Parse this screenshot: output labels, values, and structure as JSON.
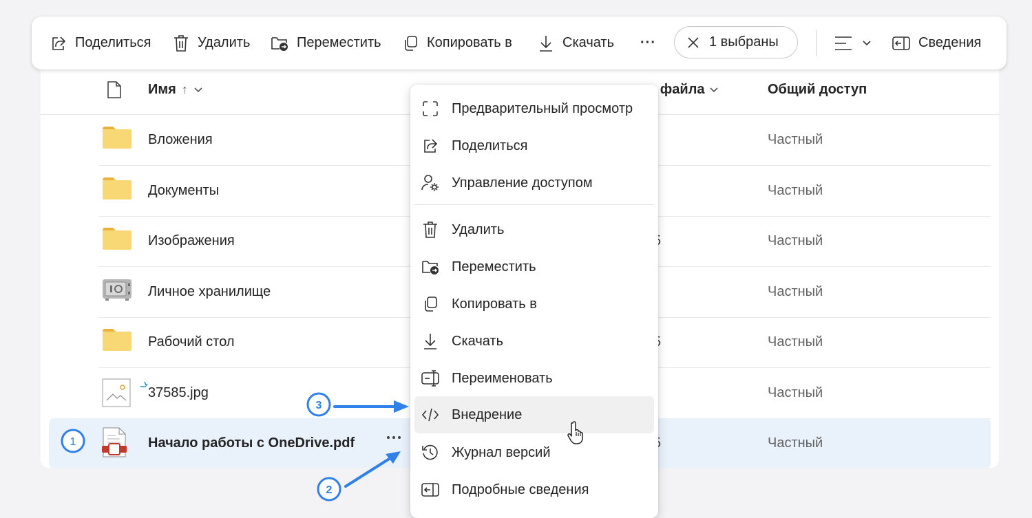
{
  "toolbar": {
    "share": "Поделиться",
    "delete": "Удалить",
    "move": "Переместить",
    "copy_to": "Копировать в",
    "download": "Скачать",
    "more": "···",
    "selection": "1 выбраны",
    "details": "Сведения"
  },
  "list_header": {
    "name": "Имя",
    "sort_glyph": "↑",
    "size": "р файла",
    "sharing": "Общий доступ"
  },
  "rows": [
    {
      "name": "Вложения",
      "size": "",
      "access": "Частный",
      "icon": "folder-icon"
    },
    {
      "name": "Документы",
      "size": "",
      "access": "Частный",
      "icon": "folder-icon"
    },
    {
      "name": "Изображения",
      "size": "5",
      "access": "Частный",
      "icon": "folder-icon"
    },
    {
      "name": "Личное хранилище",
      "size": "",
      "access": "Частный",
      "icon": "vault-icon"
    },
    {
      "name": "Рабочий стол",
      "size": "5",
      "access": "Частный",
      "icon": "folder-icon"
    },
    {
      "name": "37585.jpg",
      "size": "",
      "access": "Частный",
      "icon": "image-file-icon"
    },
    {
      "name": "Начало работы с OneDrive.pdf",
      "size": "5",
      "access": "Частный",
      "icon": "pdf-file-icon",
      "selected": true
    }
  ],
  "menu": [
    {
      "label": "Предварительный просмотр",
      "icon": "preview-icon"
    },
    {
      "label": "Поделиться",
      "icon": "share-icon"
    },
    {
      "label": "Управление доступом",
      "icon": "manage-access-icon"
    },
    {
      "label": "Удалить",
      "icon": "trash-icon"
    },
    {
      "label": "Переместить",
      "icon": "move-icon"
    },
    {
      "label": "Копировать в",
      "icon": "copy-icon"
    },
    {
      "label": "Скачать",
      "icon": "download-icon"
    },
    {
      "label": "Переименовать",
      "icon": "rename-icon"
    },
    {
      "label": "Внедрение",
      "icon": "embed-icon",
      "hover": true
    },
    {
      "label": "Журнал версий",
      "icon": "history-icon"
    },
    {
      "label": "Подробные сведения",
      "icon": "details-icon"
    }
  ],
  "annotations": [
    "1",
    "2",
    "3"
  ],
  "colors": {
    "accent": "#2f80e8",
    "selected_row": "#e9f1fb",
    "folder": "#f8d775",
    "folder_tab": "#e9b23c",
    "pdf_red": "#c0392b"
  }
}
